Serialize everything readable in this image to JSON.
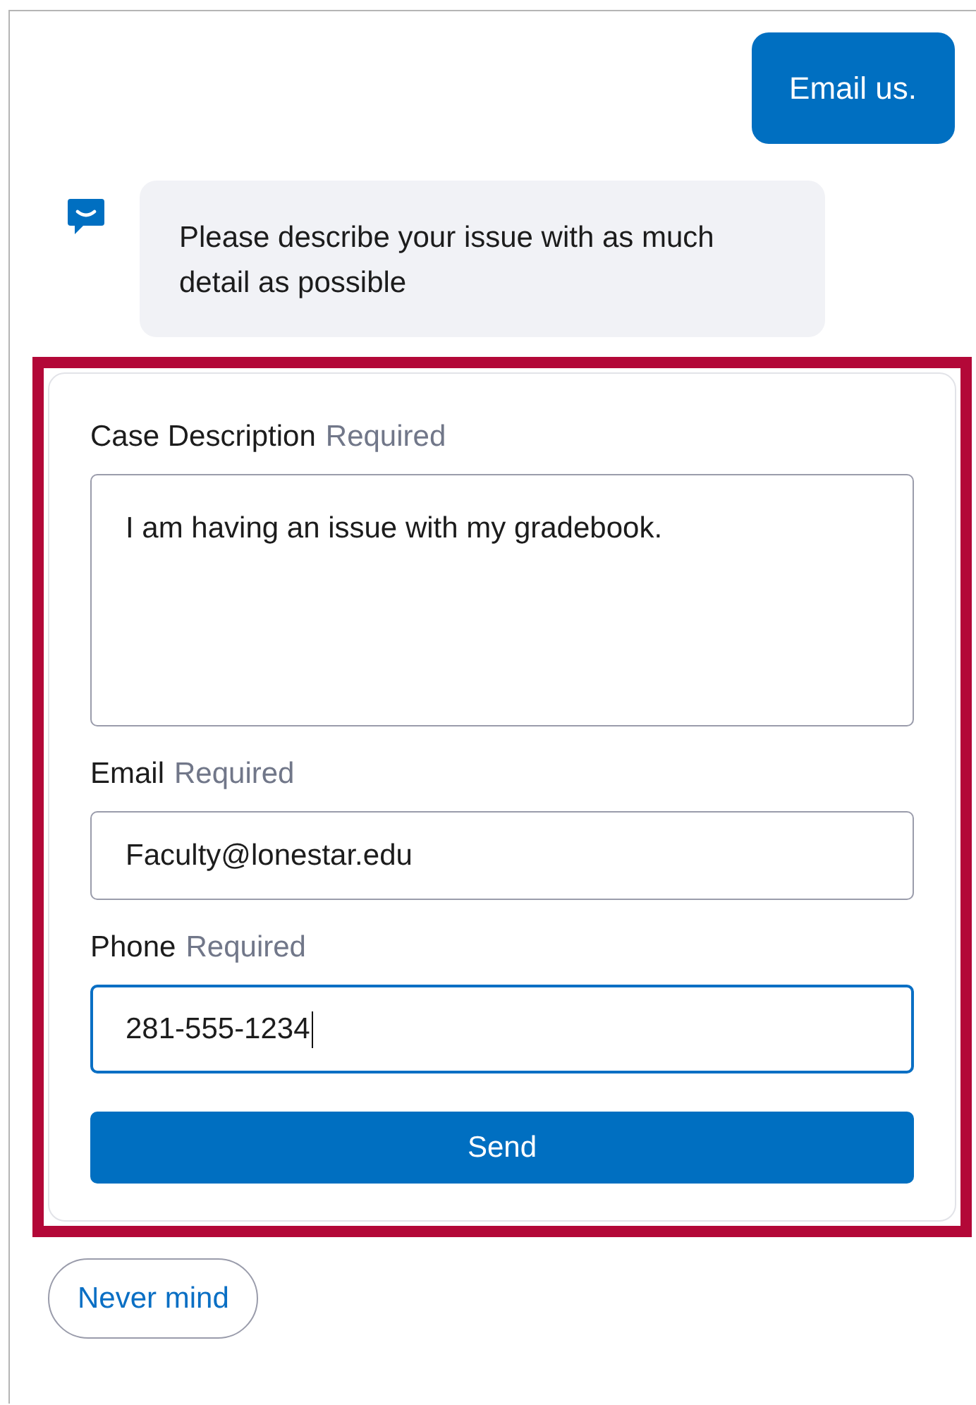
{
  "messages": [
    {
      "kind": "user",
      "text": "Email us."
    },
    {
      "kind": "bot",
      "text": "Please describe your issue with as much detail as possible"
    }
  ],
  "form": {
    "highlighted": true,
    "fields": [
      {
        "kind": "textarea",
        "label": "Case Description",
        "required_label": "Required",
        "value": "I am having an issue with my gradebook.",
        "focused": false
      },
      {
        "kind": "input",
        "label": "Email",
        "required_label": "Required",
        "value": "Faculty@lonestar.edu",
        "focused": false
      },
      {
        "kind": "input",
        "label": "Phone",
        "required_label": "Required",
        "value": "281-555-1234",
        "focused": true
      }
    ],
    "submit": "Send"
  },
  "cancel": "Never mind"
}
